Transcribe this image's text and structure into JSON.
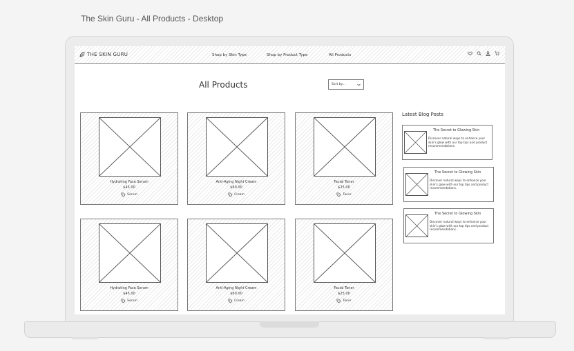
{
  "frame_title": "The Skin Guru - All Products - Desktop",
  "nav": {
    "logo_text": "THE SKIN GURU",
    "links": [
      "Shop by Skin Type",
      "Shop by Product Type",
      "All Products"
    ],
    "icons": [
      "heart-icon",
      "search-icon",
      "user-icon",
      "cart-icon"
    ]
  },
  "main": {
    "title": "All Products",
    "sort_label": "Sort by..."
  },
  "products": [
    {
      "name": "Hydrating Face Serum",
      "price": "$45.00",
      "tag": "Serum"
    },
    {
      "name": "Anti-Aging Night Cream",
      "price": "$60.00",
      "tag": "Cream"
    },
    {
      "name": "Facial Toner",
      "price": "$25.00",
      "tag": "Toner"
    },
    {
      "name": "Hydrating Face Serum",
      "price": "$45.00",
      "tag": "Serum"
    },
    {
      "name": "Anti-Aging Night Cream",
      "price": "$60.00",
      "tag": "Cream"
    },
    {
      "name": "Facial Toner",
      "price": "$25.00",
      "tag": "Toner"
    }
  ],
  "blog": {
    "heading": "Latest Blog Posts",
    "posts": [
      {
        "title": "The Secret to Glowing Skin",
        "desc": "Discover natural ways to enhance your skin's glow with our top tips and product recommendations."
      },
      {
        "title": "The Secret to Glowing Skin",
        "desc": "Discover natural ways to enhance your skin's glow with our top tips and product recommendations."
      },
      {
        "title": "The Secret to Glowing Skin",
        "desc": "Discover natural ways to enhance your skin's glow with our top tips and product recommendations."
      }
    ]
  }
}
